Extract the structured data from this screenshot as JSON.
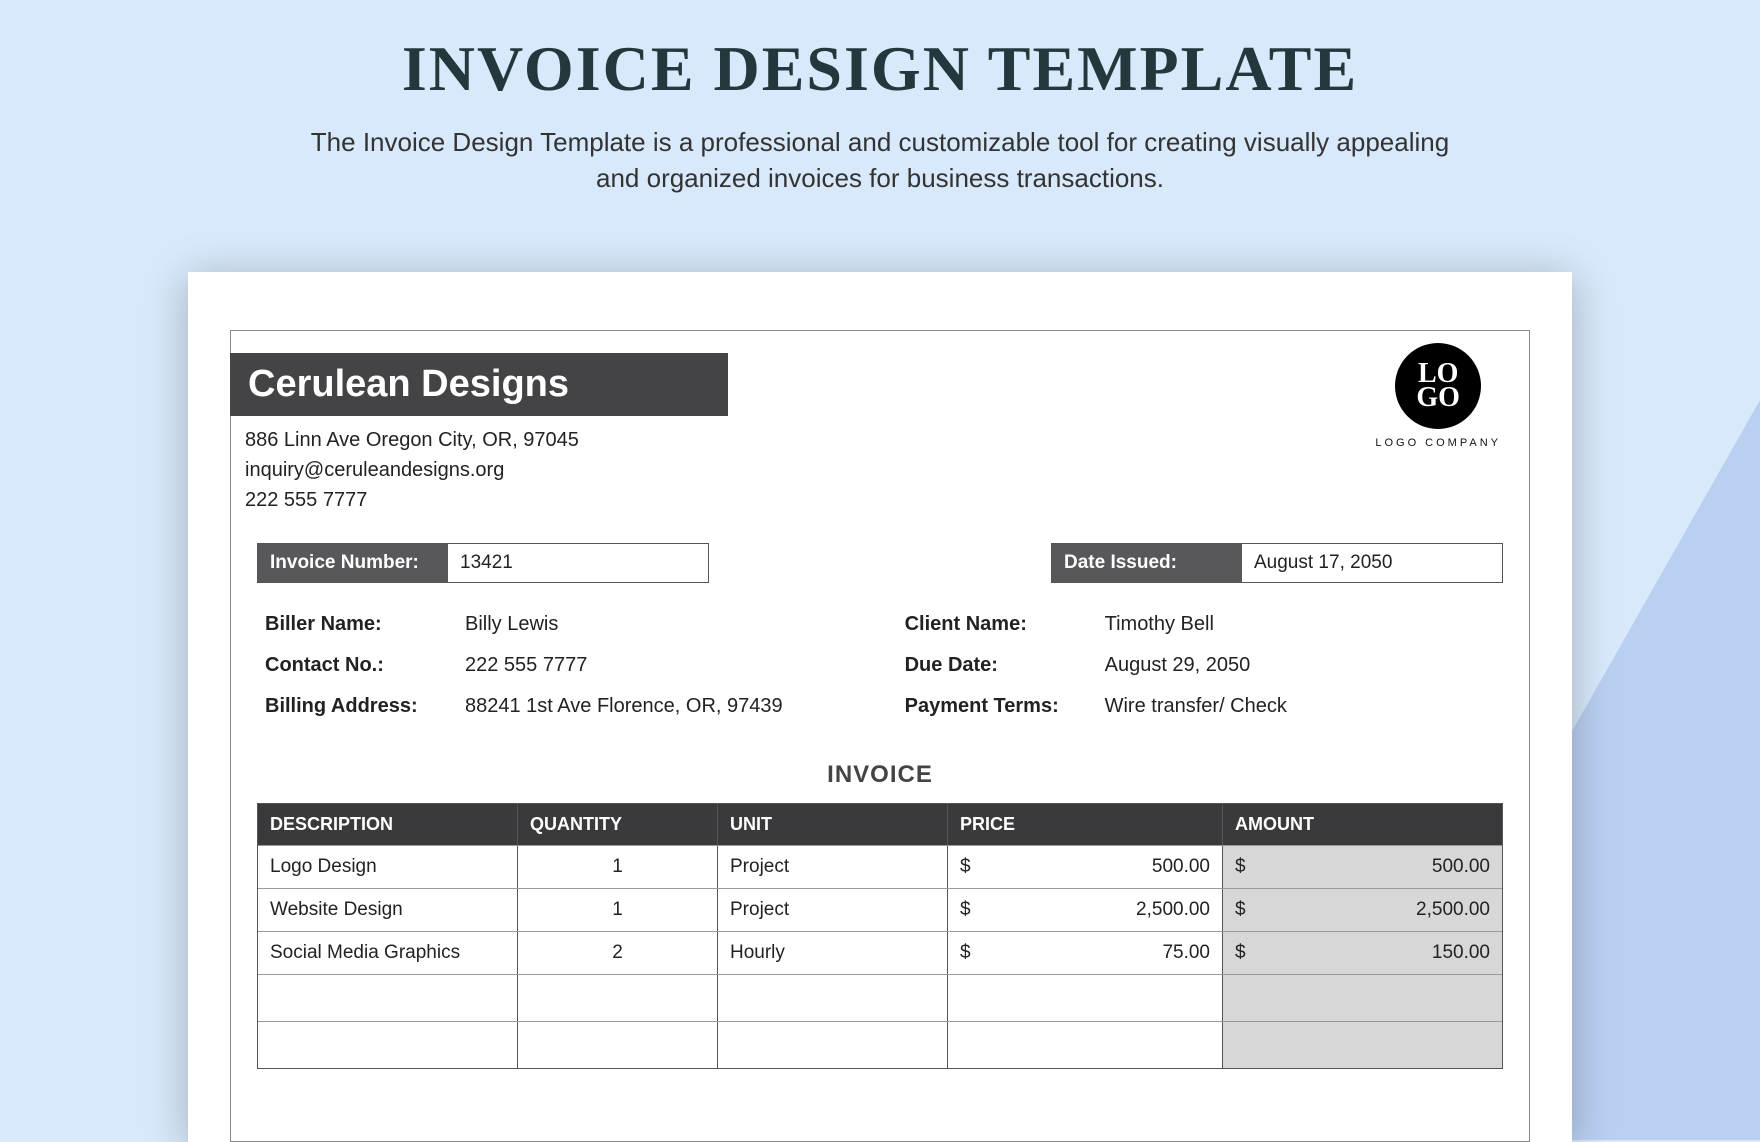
{
  "header": {
    "title": "INVOICE DESIGN TEMPLATE",
    "subtitle": "The Invoice Design Template is a professional and customizable tool for creating visually appealing and organized invoices for business transactions."
  },
  "company": {
    "name": "Cerulean Designs",
    "address": "886 Linn Ave Oregon City, OR, 97045",
    "email": "inquiry@ceruleandesigns.org",
    "phone": "222 555 7777"
  },
  "logo": {
    "line1": "LO",
    "line2": "GO",
    "caption": "LOGO COMPANY"
  },
  "meta": {
    "invoice_number_label": "Invoice Number:",
    "invoice_number": "13421",
    "date_issued_label": "Date Issued:",
    "date_issued": "August 17, 2050"
  },
  "biller": {
    "name_label": "Biller Name:",
    "name": "Billy Lewis",
    "contact_label": "Contact No.:",
    "contact": "222 555 7777",
    "address_label": "Billing Address:",
    "address": "88241 1st Ave Florence, OR, 97439"
  },
  "client": {
    "name_label": "Client Name:",
    "name": "Timothy Bell",
    "due_label": "Due Date:",
    "due": "August 29, 2050",
    "terms_label": "Payment Terms:",
    "terms": "Wire transfer/ Check"
  },
  "invoice_heading": "INVOICE",
  "columns": {
    "description": "DESCRIPTION",
    "quantity": "QUANTITY",
    "unit": "UNIT",
    "price": "PRICE",
    "amount": "AMOUNT"
  },
  "currency": "$",
  "lines": [
    {
      "description": "Logo Design",
      "quantity": "1",
      "unit": "Project",
      "price": "500.00",
      "amount": "500.00"
    },
    {
      "description": "Website Design",
      "quantity": "1",
      "unit": "Project",
      "price": "2,500.00",
      "amount": "2,500.00"
    },
    {
      "description": "Social Media Graphics",
      "quantity": "2",
      "unit": "Hourly",
      "price": "75.00",
      "amount": "150.00"
    }
  ]
}
